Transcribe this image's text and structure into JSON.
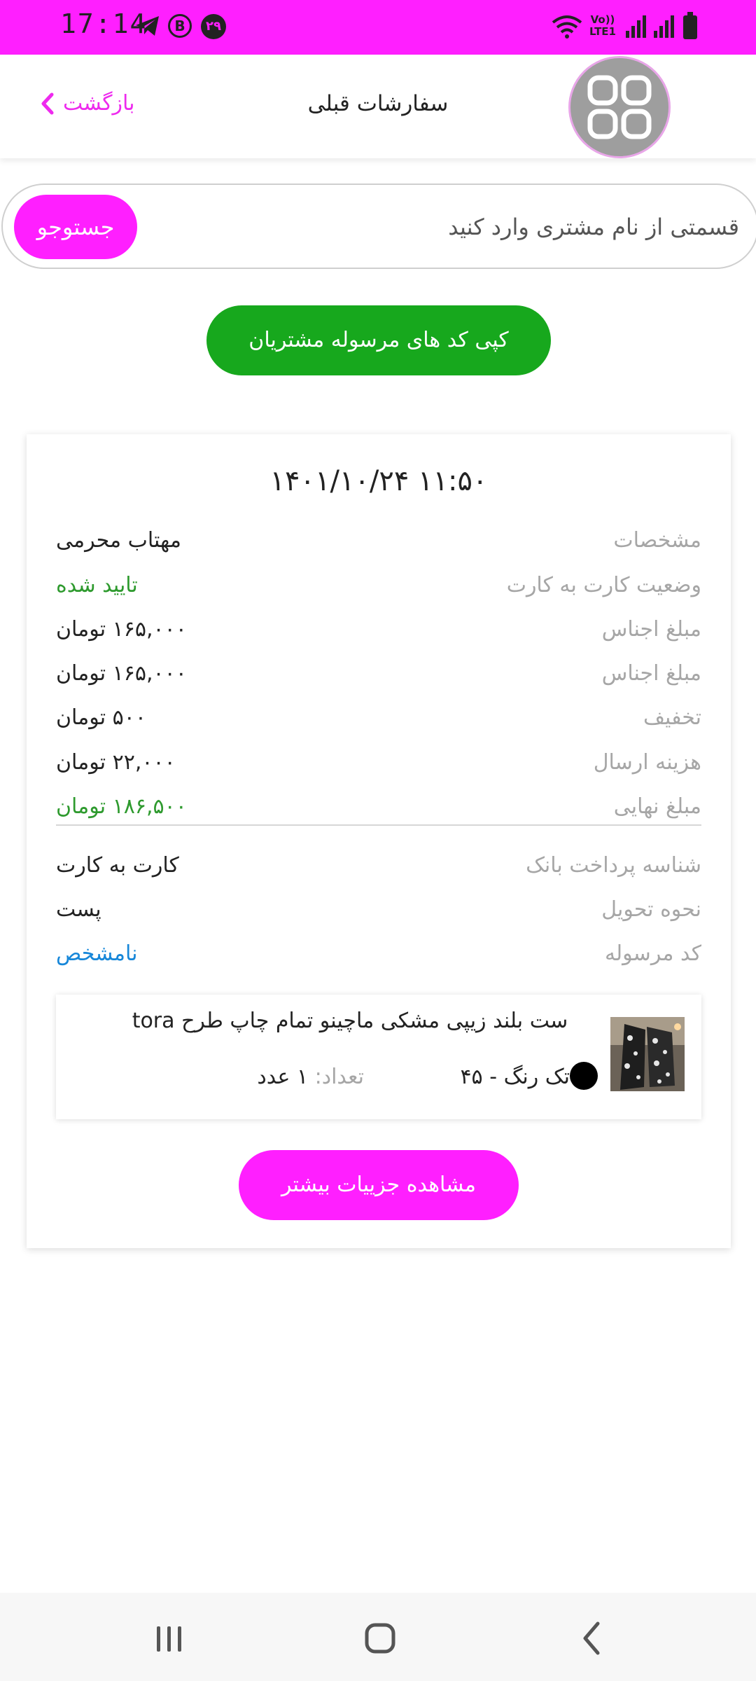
{
  "status_bar": {
    "time": "17:14",
    "notification_badge": "۲۹",
    "b_icon_letter": "B",
    "network_label_top": "Vo))",
    "network_label_bottom": "LTE1",
    "background_color": "#ff1fff"
  },
  "header": {
    "back_label": "بازگشت",
    "title": "سفارشات قبلی"
  },
  "search": {
    "placeholder": "قسمتی از نام مشتری وارد کنید",
    "value": "",
    "button_label": "جستوجو"
  },
  "copy_button_label": "کپی کد های مرسوله مشتریان",
  "order": {
    "datetime": "۱۴۰۱/۱۰/۲۴ ۱۱:۵۰",
    "rows": [
      {
        "label": "مشخصات",
        "value": "مهتاب محرمی"
      },
      {
        "label": "وضعیت کارت به کارت",
        "value": "تایید شده"
      },
      {
        "label": "مبلغ اجناس",
        "value": "۱۶۵,۰۰۰ تومان"
      },
      {
        "label": "مبلغ اجناس",
        "value": "۱۶۵,۰۰۰ تومان"
      },
      {
        "label": "تخفیف",
        "value": "۵۰۰ تومان"
      },
      {
        "label": "هزینه ارسال",
        "value": "۲۲,۰۰۰ تومان"
      },
      {
        "label": "مبلغ نهایی",
        "value": "۱۸۶,۵۰۰ تومان"
      },
      {
        "label": "شناسه پرداخت بانک",
        "value": "کارت به کارت"
      },
      {
        "label": "نحوه تحویل",
        "value": "پست"
      },
      {
        "label": "کد مرسوله",
        "value": "نامشخص"
      }
    ],
    "product": {
      "name": "ست بلند زیپی مشکی ماچینو تمام چاپ طرح tora",
      "variant": "تک رنگ  - ۴۵",
      "quantity_label": "تعداد:",
      "quantity_value": "۱ عدد"
    },
    "details_button_label": "مشاهده جزییات بیشتر"
  },
  "colors": {
    "accent_pink": "#ff1fff",
    "action_green": "#17a81d",
    "status_green": "#2e9a2e",
    "link_blue": "#1787d9"
  }
}
